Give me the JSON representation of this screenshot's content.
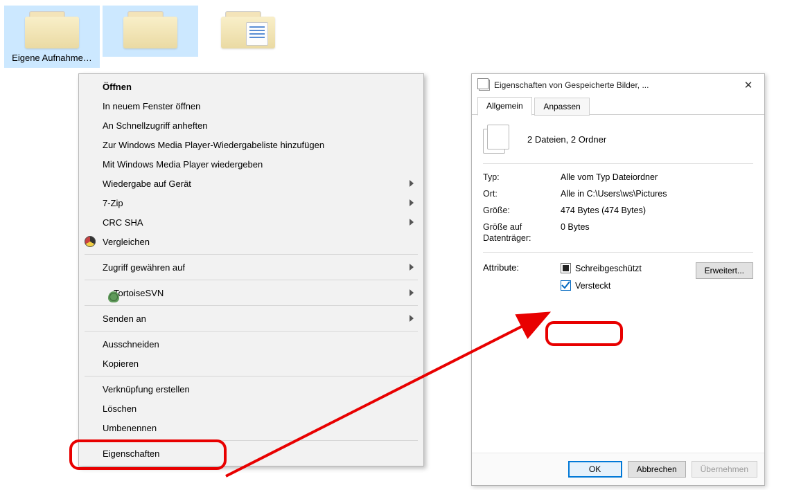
{
  "explorer": {
    "items": [
      {
        "label": "Eigene Aufnahme…",
        "selected": true,
        "hasDocs": false
      },
      {
        "label": "",
        "selected": true,
        "hasDocs": false
      },
      {
        "label": "",
        "selected": false,
        "hasDocs": true
      }
    ]
  },
  "contextMenu": {
    "items": [
      {
        "label": "Öffnen",
        "bold": true
      },
      {
        "label": "In neuem Fenster öffnen"
      },
      {
        "label": "An Schnellzugriff anheften"
      },
      {
        "label": "Zur Windows Media Player-Wiedergabeliste hinzufügen"
      },
      {
        "label": "Mit Windows Media Player wiedergeben"
      },
      {
        "label": "Wiedergabe auf Gerät",
        "submenu": true
      },
      {
        "label": "7-Zip",
        "submenu": true
      },
      {
        "label": "CRC SHA",
        "submenu": true
      },
      {
        "label": "Vergleichen",
        "icon": "compare"
      },
      {
        "sep": true
      },
      {
        "label": "Zugriff gewähren auf",
        "submenu": true
      },
      {
        "sep": true
      },
      {
        "label": "TortoiseSVN",
        "icon": "tortoise",
        "submenu": true
      },
      {
        "sep": true
      },
      {
        "label": "Senden an",
        "submenu": true
      },
      {
        "sep": true
      },
      {
        "label": "Ausschneiden"
      },
      {
        "label": "Kopieren"
      },
      {
        "sep": true
      },
      {
        "label": "Verknüpfung erstellen"
      },
      {
        "label": "Löschen"
      },
      {
        "label": "Umbenennen"
      },
      {
        "sep": true
      },
      {
        "label": "Eigenschaften"
      }
    ]
  },
  "dialog": {
    "title": "Eigenschaften von Gespeicherte Bilder, ...",
    "tabs": {
      "general": "Allgemein",
      "customize": "Anpassen"
    },
    "summary": "2 Dateien, 2 Ordner",
    "rows": {
      "type_k": "Typ:",
      "type_v": "Alle vom Typ Dateiordner",
      "loc_k": "Ort:",
      "loc_v": "Alle in C:\\Users\\ws\\Pictures",
      "size_k": "Größe:",
      "size_v": "474 Bytes (474 Bytes)",
      "diskSize_k": "Größe auf Datenträger:",
      "diskSize_v": "0 Bytes"
    },
    "attributes": {
      "label": "Attribute:",
      "readonly": "Schreibgeschützt",
      "hidden": "Versteckt",
      "advanced": "Erweitert..."
    },
    "buttons": {
      "ok": "OK",
      "cancel": "Abbrechen",
      "apply": "Übernehmen"
    }
  }
}
